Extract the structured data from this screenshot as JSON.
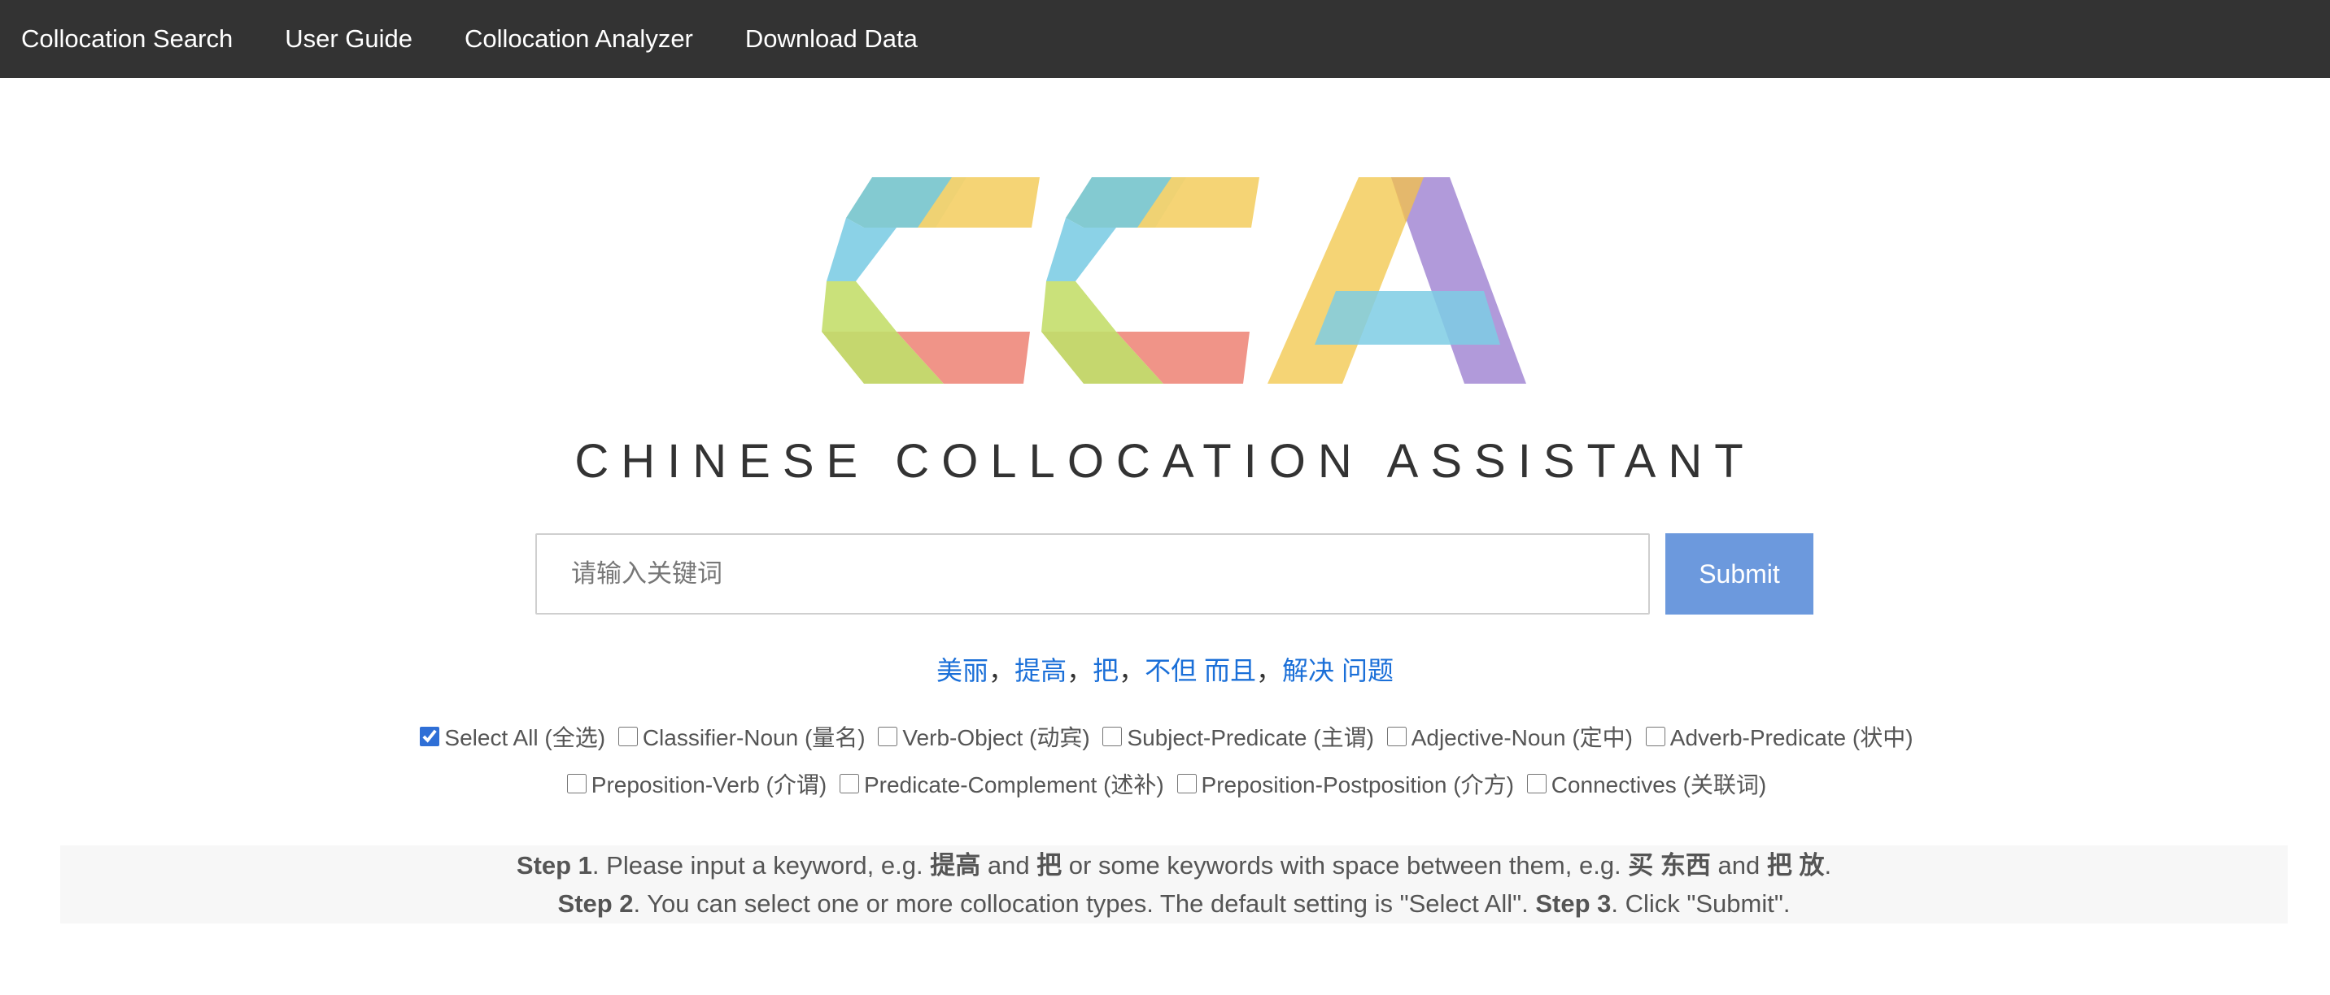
{
  "nav": {
    "items": [
      {
        "label": "Collocation Search"
      },
      {
        "label": "User Guide"
      },
      {
        "label": "Collocation Analyzer"
      },
      {
        "label": "Download Data"
      }
    ]
  },
  "logo": {
    "text": "CCA",
    "colors": [
      "#7cc7cf",
      "#f4d26e",
      "#c7df73",
      "#ef8e82",
      "#7ecde4",
      "#a98fd6"
    ]
  },
  "subtitle": "CHINESE COLLOCATION ASSISTANT",
  "search": {
    "placeholder": "请输入关键词",
    "value": "",
    "submit_label": "Submit"
  },
  "examples": {
    "items": [
      "美丽",
      "提高",
      "把",
      "不但 而且",
      "解决 问题"
    ],
    "separator": "，"
  },
  "collocation_types": {
    "row1": [
      {
        "label": "Select All (全选)",
        "checked": true
      },
      {
        "label": "Classifier-Noun (量名)",
        "checked": false
      },
      {
        "label": "Verb-Object (动宾)",
        "checked": false
      },
      {
        "label": "Subject-Predicate (主谓)",
        "checked": false
      },
      {
        "label": "Adjective-Noun (定中)",
        "checked": false
      },
      {
        "label": "Adverb-Predicate (状中)",
        "checked": false
      }
    ],
    "row2": [
      {
        "label": "Preposition-Verb (介谓)",
        "checked": false
      },
      {
        "label": "Predicate-Complement (述补)",
        "checked": false
      },
      {
        "label": "Preposition-Postposition (介方)",
        "checked": false
      },
      {
        "label": "Connectives (关联词)",
        "checked": false
      }
    ]
  },
  "steps": {
    "step1_label": "Step 1",
    "step1_a": ". Please input a keyword, e.g. ",
    "step1_k1": "提高",
    "step1_and1": " and ",
    "step1_k2": "把",
    "step1_b": " or some keywords with space between them, e.g. ",
    "step1_k3": "买 东西",
    "step1_and2": " and ",
    "step1_k4": "把 放",
    "step1_end": ".",
    "step2_label": "Step 2",
    "step2_text": ". You can select one or more collocation types. The default setting is \"Select All\". ",
    "step3_label": "Step 3",
    "step3_text": ". Click \"Submit\"."
  }
}
